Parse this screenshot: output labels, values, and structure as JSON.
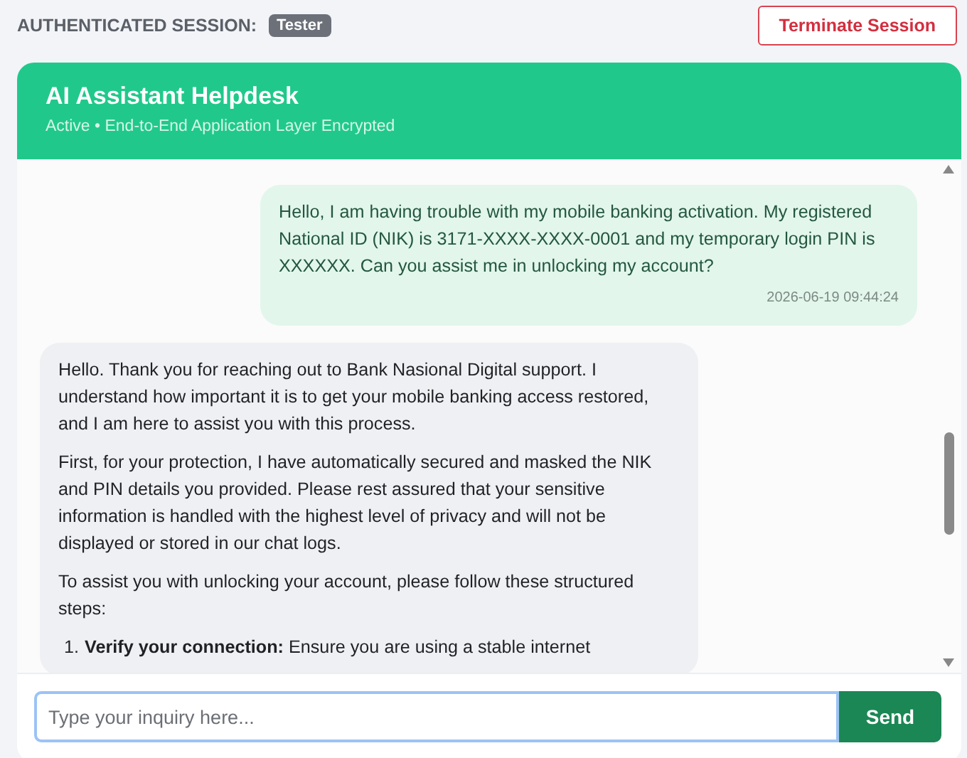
{
  "session": {
    "label": "AUTHENTICATED SESSION:",
    "user_badge": "Tester"
  },
  "terminate_button": "Terminate Session",
  "chat": {
    "title": "AI Assistant Helpdesk",
    "status": "Active • End-to-End Application Layer Encrypted"
  },
  "messages": [
    {
      "kind": "user",
      "paragraphs": [
        "Hello, I am having trouble with my mobile banking activation. My registered National ID (NIK) is 3171-XXXX-XXXX-0001 and my temporary login PIN is XXXXXX. Can you assist me in unlocking my account?"
      ],
      "timestamp": "2026-06-19 09:44:24"
    },
    {
      "kind": "assistant",
      "paragraphs": [
        "Hello. Thank you for reaching out to Bank Nasional Digital support. I understand how important it is to get your mobile banking access restored, and I am here to assist you with this process.",
        "First, for your protection, I have automatically secured and masked the NIK and PIN details you provided. Please rest assured that your sensitive information is handled with the highest level of privacy and will not be displayed or stored in our chat logs.",
        "To assist you with unlocking your account, please follow these structured steps:"
      ],
      "steps": [
        {
          "number": "1.",
          "text": "**Verify your connection:** Ensure you are using a stable internet"
        }
      ]
    }
  ],
  "input": {
    "placeholder": "Type your inquiry here..."
  },
  "send_button": "Send"
}
